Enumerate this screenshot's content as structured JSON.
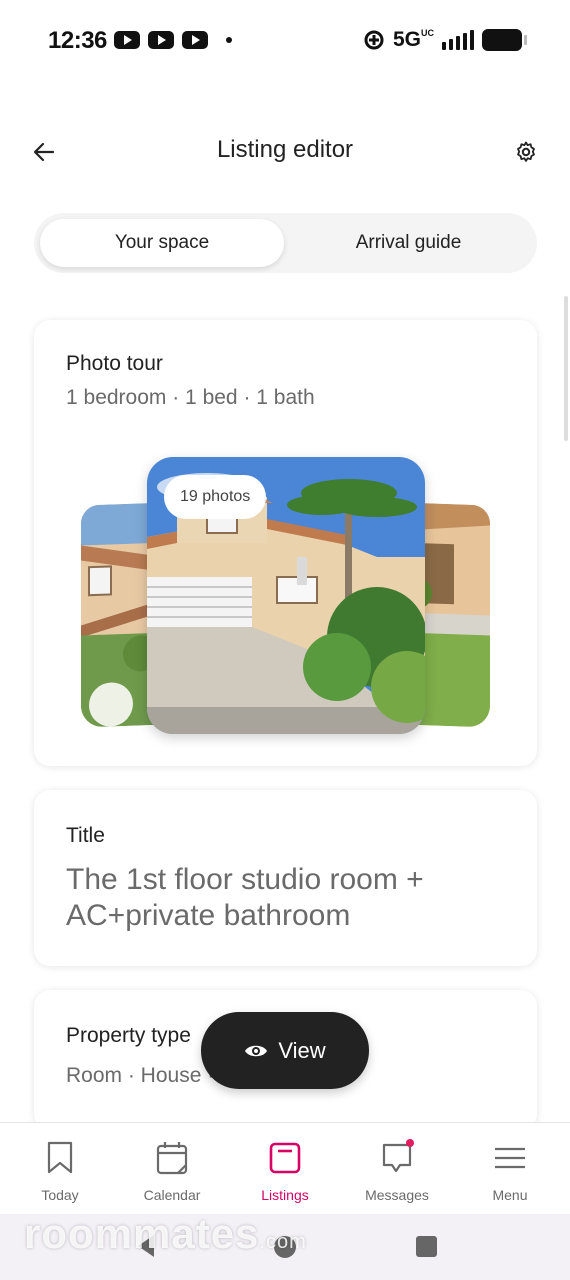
{
  "status_bar": {
    "time": "12:36",
    "network": "5G",
    "network_suffix": "UC",
    "icons": [
      "youtube-icon",
      "youtube-icon",
      "youtube-icon",
      "notification-dot",
      "data-saver-icon",
      "signal-icon",
      "battery-icon"
    ]
  },
  "header": {
    "title": "Listing editor",
    "back_icon": "arrow-left-icon",
    "settings_icon": "gear-icon"
  },
  "tabs": [
    {
      "label": "Your space",
      "active": true
    },
    {
      "label": "Arrival guide",
      "active": false
    }
  ],
  "photo_tour": {
    "title": "Photo tour",
    "subtitle": "1 bedroom · 1 bed · 1 bath",
    "photo_count": "19 photos"
  },
  "title_section": {
    "label": "Title",
    "value": "The 1st floor studio room + AC+private bathroom"
  },
  "property_type": {
    "label": "Property type",
    "value": "Room · House · Category"
  },
  "view_button": {
    "label": "View",
    "icon": "eye-icon"
  },
  "bottom_nav": {
    "items": [
      {
        "label": "Today",
        "icon": "bookmark-icon"
      },
      {
        "label": "Calendar",
        "icon": "calendar-icon"
      },
      {
        "label": "Listings",
        "icon": "listings-icon",
        "active": true
      },
      {
        "label": "Messages",
        "icon": "message-icon",
        "has_badge": true
      },
      {
        "label": "Menu",
        "icon": "menu-icon"
      }
    ]
  },
  "watermark": {
    "text": "roommates",
    "suffix": ".com"
  },
  "colors": {
    "accent": "#d70466",
    "badge": "#e31c5f",
    "text_primary": "#222222",
    "text_secondary": "#6a6a6a"
  }
}
